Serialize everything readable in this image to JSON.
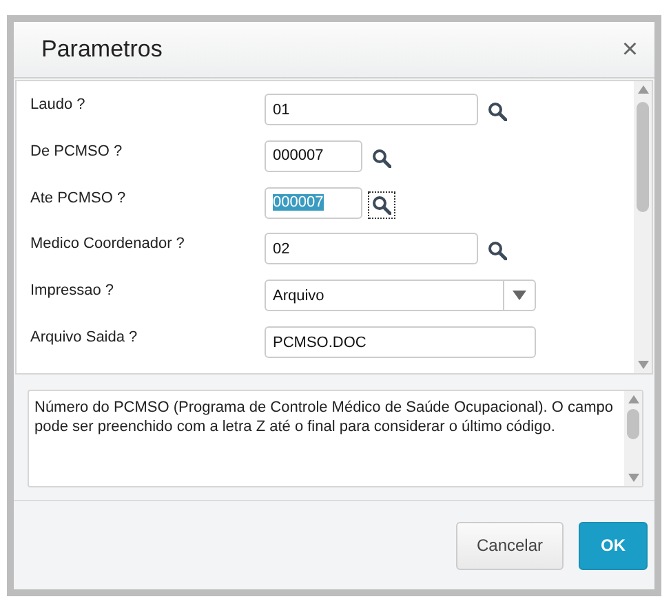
{
  "window": {
    "title": "Parametros",
    "close": "×"
  },
  "fields": [
    {
      "label": "Laudo ?",
      "kind": "lookup",
      "value": "01",
      "focused": false
    },
    {
      "label": "De PCMSO ?",
      "kind": "lookup",
      "value": "000007",
      "focused": false
    },
    {
      "label": "Ate PCMSO ?",
      "kind": "lookup",
      "value": "000007",
      "focused": true
    },
    {
      "label": "Medico Coordenador ?",
      "kind": "lookup",
      "value": "02",
      "focused": false
    },
    {
      "label": "Impressao ?",
      "kind": "combo",
      "value": "Arquivo",
      "focused": false
    },
    {
      "label": "Arquivo Saida ?",
      "kind": "text",
      "value": "PCMSO.DOC",
      "focused": false
    }
  ],
  "help": "Número do PCMSO (Programa de Controle Médico de Saúde Ocupacional). O campo pode ser preenchido com a letra Z até o final para considerar o último código.",
  "buttons": [
    {
      "label": "Cancelar",
      "kind": "secondary"
    },
    {
      "label": "OK",
      "kind": "primary"
    }
  ]
}
